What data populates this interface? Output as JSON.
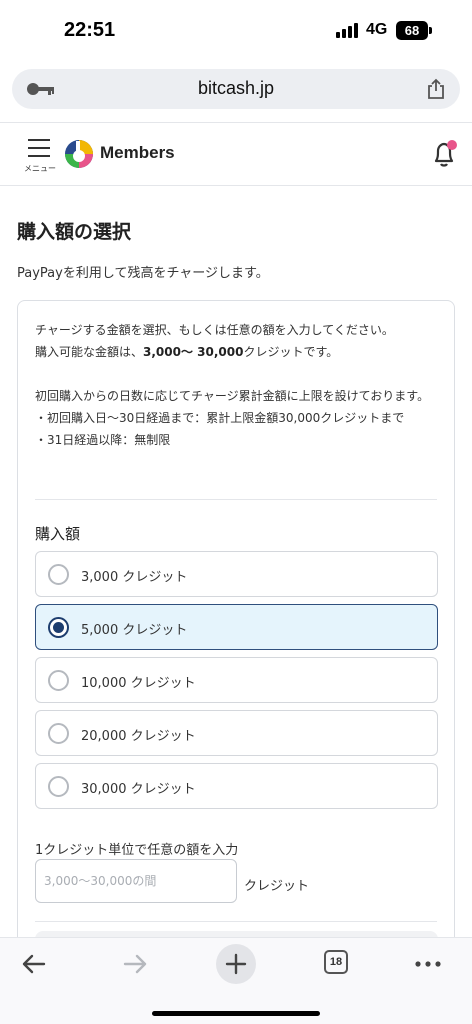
{
  "status_bar": {
    "time": "22:51",
    "network": "4G",
    "battery": "68"
  },
  "browser": {
    "url": "bitcash.jp",
    "tab_count": "18"
  },
  "header": {
    "menu_label": "メニュー",
    "brand": "Members"
  },
  "page": {
    "title": "購入額の選択",
    "lead": "PayPayを利用して残高をチャージします。"
  },
  "notice": {
    "line1": "チャージする金額を選択、もしくは任意の額を入力してください。",
    "line2_prefix": "購入可能な金額は、",
    "line2_bold": "3,000〜 30,000",
    "line2_suffix": "クレジットです。",
    "line3": "初回購入からの日数に応じてチャージ累計金額に上限を設けております。",
    "bullet1": "・初回購入日〜30日経過まで：累計上限金額30,000クレジットまで",
    "bullet2": "・31日経過以降：無制限"
  },
  "purchase": {
    "label": "購入額",
    "options": [
      {
        "label": "3,000 クレジット",
        "selected": false
      },
      {
        "label": "5,000 クレジット",
        "selected": true
      },
      {
        "label": "10,000 クレジット",
        "selected": false
      },
      {
        "label": "20,000 クレジット",
        "selected": false
      },
      {
        "label": "30,000 クレジット",
        "selected": false
      }
    ],
    "custom_label": "1クレジット単位で任意の額を入力",
    "custom_placeholder": "3,000〜30,000の間",
    "custom_unit": "クレジット"
  },
  "colors": {
    "accent": "#1d3d6e",
    "selected_bg": "#e5f4fc",
    "notification_dot": "#e8548a"
  }
}
